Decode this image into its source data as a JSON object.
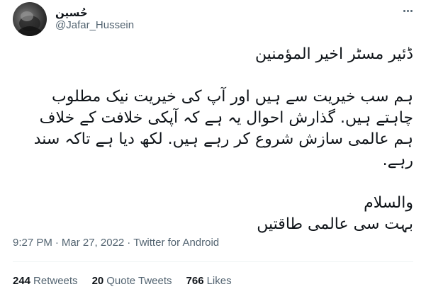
{
  "author": {
    "display_name": "حُسین",
    "handle": "@Jafar_Hussein"
  },
  "tweet": {
    "greeting": "ڈئیر مسٹر اخیر المؤمنین",
    "body": "ہم سب خیریت سے ہیں اور آپ کی خیریت نیک مطلوب چاہتے ہیں. گذارش احوال یہ ہے کہ آپکی خلافت کے خلاف ہم عالمی سازش شروع کر رہے ہیں. لکھ دیا ہے تاکہ سند رہے.",
    "closing": "والسلام",
    "signature": "بہت سی عالمی طاقتیں"
  },
  "meta": {
    "time": "9:27 PM",
    "date": "Mar 27, 2022",
    "source": "Twitter for Android",
    "separator": "·"
  },
  "stats": {
    "retweets_count": "244",
    "retweets_label": "Retweets",
    "quotes_count": "20",
    "quotes_label": "Quote Tweets",
    "likes_count": "766",
    "likes_label": "Likes"
  },
  "icons": {
    "more": "more-icon",
    "avatar": "avatar"
  },
  "colors": {
    "text": "#0f1419",
    "secondary": "#536471",
    "divider": "#eff3f4"
  }
}
